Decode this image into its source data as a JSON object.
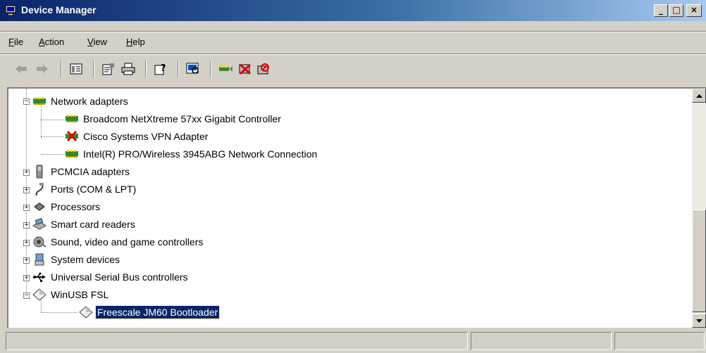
{
  "window": {
    "title": "Device Manager",
    "controls": {
      "minimize": "_",
      "maximize": "□",
      "close": "×"
    }
  },
  "menu": [
    {
      "label": "File",
      "accel": "F",
      "rest": "ile"
    },
    {
      "label": "Action",
      "accel": "A",
      "rest": "ction"
    },
    {
      "label": "View",
      "accel": "V",
      "rest": "iew"
    },
    {
      "label": "Help",
      "accel": "H",
      "rest": "elp"
    }
  ],
  "toolbar": [
    {
      "name": "back-icon",
      "glyph": "⇐"
    },
    {
      "name": "forward-icon",
      "glyph": "⇒"
    },
    {
      "name": "show-hide-console-tree-icon",
      "glyph": "▣"
    },
    {
      "name": "properties-icon",
      "glyph": "🗎"
    },
    {
      "name": "print-icon",
      "glyph": "🖶"
    },
    {
      "name": "help-icon",
      "glyph": "?"
    },
    {
      "name": "scan-hardware-icon",
      "glyph": "⌕"
    },
    {
      "name": "update-driver-icon",
      "glyph": "⇄"
    },
    {
      "name": "uninstall-icon",
      "glyph": "✖"
    },
    {
      "name": "disable-icon",
      "glyph": "⊘"
    }
  ],
  "tree": [
    {
      "label": "Network adapters",
      "icon": "network-adapter-icon",
      "level": 0,
      "expander": "−"
    },
    {
      "label": "Broadcom NetXtreme 57xx Gigabit Controller",
      "icon": "network-adapter-icon",
      "level": 1
    },
    {
      "label": "Cisco Systems VPN Adapter",
      "icon": "network-adapter-disabled-icon",
      "level": 1
    },
    {
      "label": "Intel(R) PRO/Wireless 3945ABG Network Connection",
      "icon": "network-adapter-icon",
      "level": 1
    },
    {
      "label": "PCMCIA adapters",
      "icon": "pcmcia-icon",
      "level": 0,
      "expander": "+"
    },
    {
      "label": "Ports (COM & LPT)",
      "icon": "port-icon",
      "level": 0,
      "expander": "+"
    },
    {
      "label": "Processors",
      "icon": "processor-icon",
      "level": 0,
      "expander": "+"
    },
    {
      "label": "Smart card readers",
      "icon": "smart-card-icon",
      "level": 0,
      "expander": "+"
    },
    {
      "label": "Sound, video and game controllers",
      "icon": "sound-icon",
      "level": 0,
      "expander": "+"
    },
    {
      "label": "System devices",
      "icon": "system-device-icon",
      "level": 0,
      "expander": "+"
    },
    {
      "label": "Universal Serial Bus controllers",
      "icon": "usb-icon",
      "level": 0,
      "expander": "+"
    },
    {
      "label": "WinUSB FSL",
      "icon": "winusb-icon",
      "level": 0,
      "expander": "−"
    },
    {
      "label": "Freescale JM60 Bootloader",
      "icon": "winusb-icon",
      "level": 1,
      "selected": true
    }
  ],
  "statusbar": {
    "panels": [
      "",
      "",
      ""
    ]
  }
}
